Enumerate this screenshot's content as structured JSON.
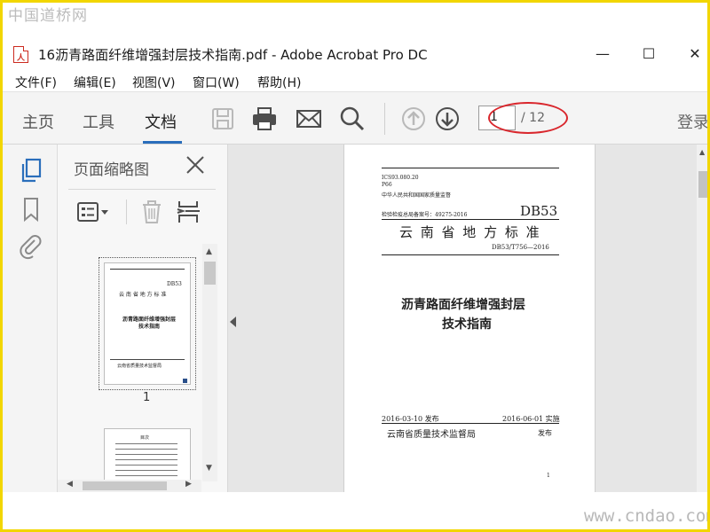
{
  "watermarks": {
    "top": "中国道桥网",
    "bottom": "www.cndao.com"
  },
  "window": {
    "title": "16沥青路面纤维增强封层技术指南.pdf - Adobe Acrobat Pro DC",
    "controls": {
      "minimize": "—",
      "maximize": "☐",
      "close": "✕"
    }
  },
  "menu": [
    "文件(F)",
    "编辑(E)",
    "视图(V)",
    "窗口(W)",
    "帮助(H)"
  ],
  "toolbar": {
    "tabs": [
      "主页",
      "工具",
      "文档"
    ],
    "active_tab": "文档",
    "page_current": "1",
    "page_total": "/ 12",
    "login": "登录",
    "icons": [
      "save-icon",
      "print-icon",
      "email-icon",
      "search-icon",
      "prev-page-icon",
      "next-page-icon"
    ]
  },
  "left_rail": {
    "icons": [
      "page-thumbnails-icon",
      "bookmark-icon",
      "attachment-icon"
    ]
  },
  "thumbnail_panel": {
    "title": "页面缩略图",
    "tools": [
      "options-icon",
      "delete-icon",
      "insert-icon"
    ],
    "thumbnails": [
      {
        "label": "1",
        "lines": [
          "DB53",
          "云 南 省 地 方 标 准",
          "沥青路面纤维增强封层",
          "技术指南",
          "云南省质量技术监督局"
        ]
      },
      {
        "label": "",
        "lines": [
          "目次"
        ]
      }
    ]
  },
  "document": {
    "header_left": [
      "ICS93.080.20",
      "P66",
      "中华人民共和国国家质量监督"
    ],
    "record_no": "检验检疫总局备案号：49275-2016",
    "code": "DB53",
    "category": "云 南 省 地 方 标 准",
    "standard_no": "DB53/T756—2016",
    "title_line1": "沥青路面纤维增强封层",
    "title_line2": "技术指南",
    "issued": "2016-03-10 发布",
    "effective": "2016-06-01 实施",
    "issuer": "云南省质量技术监督局",
    "issuer_suffix": "发布",
    "page_number": "1"
  }
}
